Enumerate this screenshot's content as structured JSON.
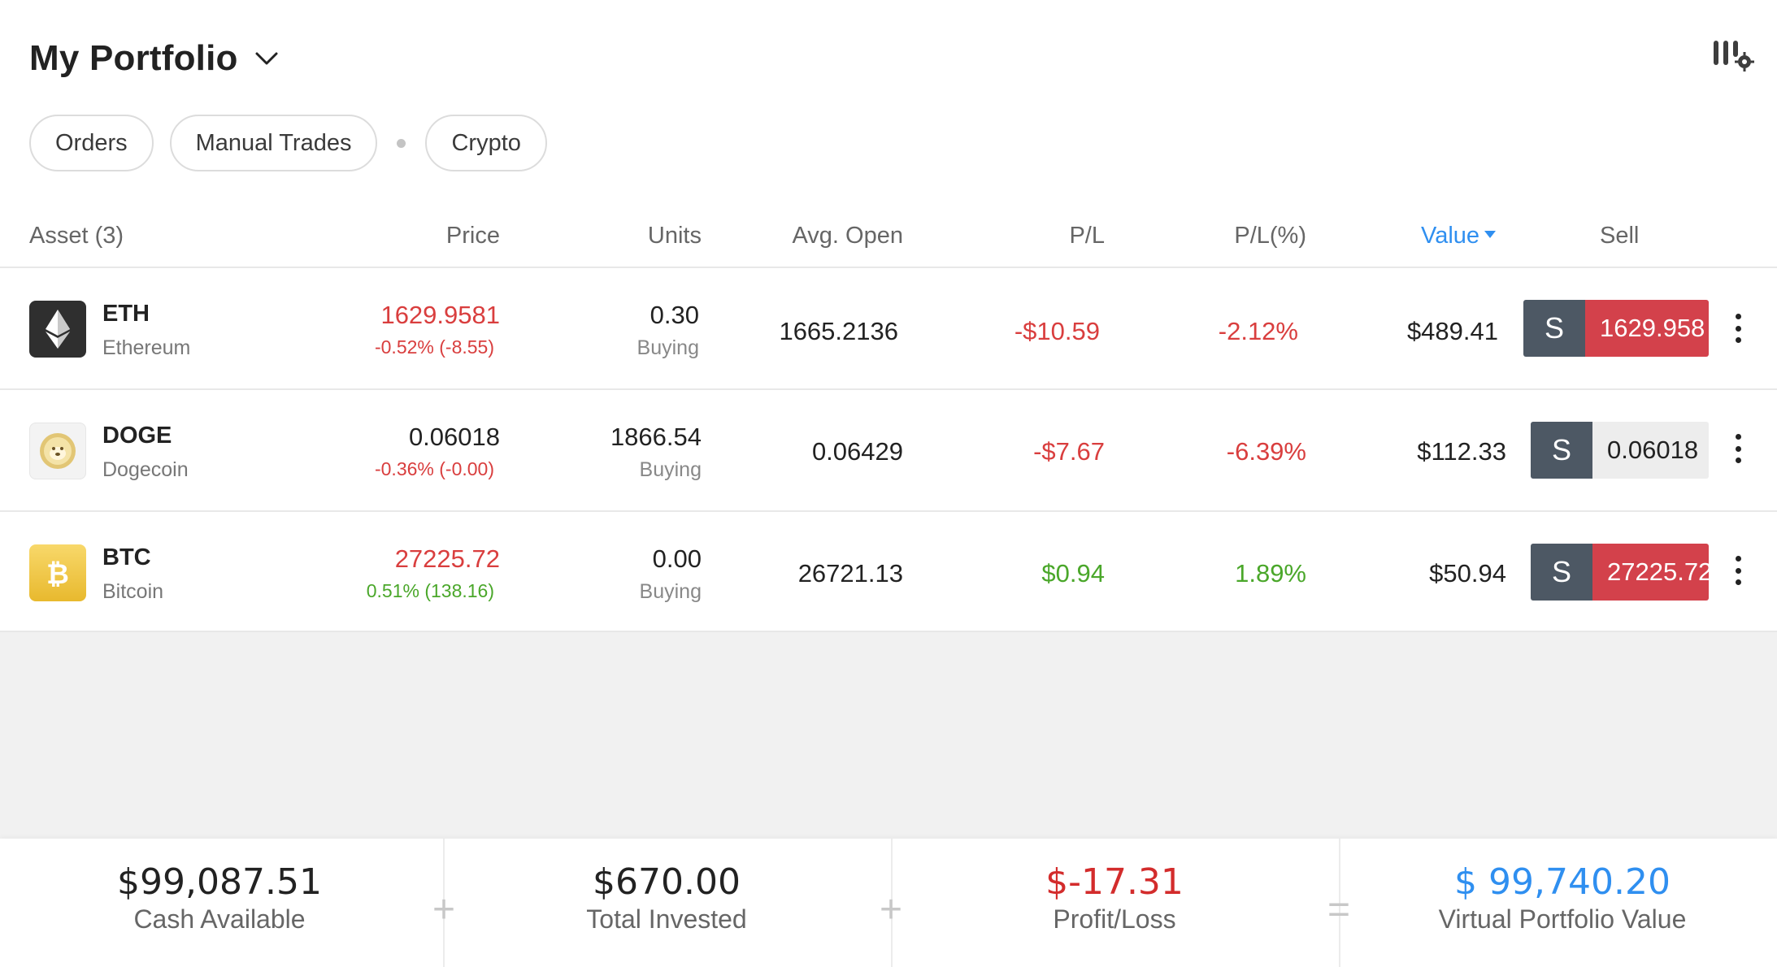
{
  "header": {
    "title": "My Portfolio",
    "chevron_icon": "chevron-down-icon",
    "settings_icon": "columns-settings-icon"
  },
  "filters": {
    "orders": "Orders",
    "manual_trades": "Manual Trades",
    "crypto": "Crypto"
  },
  "table": {
    "headers": {
      "asset": "Asset (3)",
      "price": "Price",
      "units": "Units",
      "avg_open": "Avg. Open",
      "pl": "P/L",
      "pl_pct": "P/L(%)",
      "value": "Value",
      "sell": "Sell"
    },
    "rows": [
      {
        "symbol": "ETH",
        "name": "Ethereum",
        "price": "1629.9581",
        "price_change": "-0.52% (-8.55)",
        "units": "0.30",
        "units_status": "Buying",
        "avg_open": "1665.2136",
        "pl": "-$10.59",
        "pl_pct": "-2.12%",
        "value": "$489.41",
        "sell_label": "S",
        "sell_price": "1629.958"
      },
      {
        "symbol": "DOGE",
        "name": "Dogecoin",
        "price": "0.06018",
        "price_change": "-0.36% (-0.00)",
        "units": "1866.54",
        "units_status": "Buying",
        "avg_open": "0.06429",
        "pl": "-$7.67",
        "pl_pct": "-6.39%",
        "value": "$112.33",
        "sell_label": "S",
        "sell_price": "0.06018"
      },
      {
        "symbol": "BTC",
        "name": "Bitcoin",
        "price": "27225.72",
        "price_change": "0.51% (138.16)",
        "units": "0.00",
        "units_status": "Buying",
        "avg_open": "26721.13",
        "pl": "$0.94",
        "pl_pct": "1.89%",
        "value": "$50.94",
        "sell_label": "S",
        "sell_price": "27225.72"
      }
    ]
  },
  "footer": {
    "cash_value": "$99,087.51",
    "cash_label": "Cash Available",
    "invested_value": "$670.00",
    "invested_label": "Total Invested",
    "pl_value": "$-17.31",
    "pl_label": "Profit/Loss",
    "portfolio_value": "$ 99,740.20",
    "portfolio_label": "Virtual Portfolio Value",
    "op_plus": "+",
    "op_equals": "="
  },
  "colors": {
    "negative": "#d93e3e",
    "positive": "#4aa72a",
    "accent": "#2f8ff0",
    "sell_button": "#4d5864",
    "sell_price_bg": "#d3414b"
  }
}
